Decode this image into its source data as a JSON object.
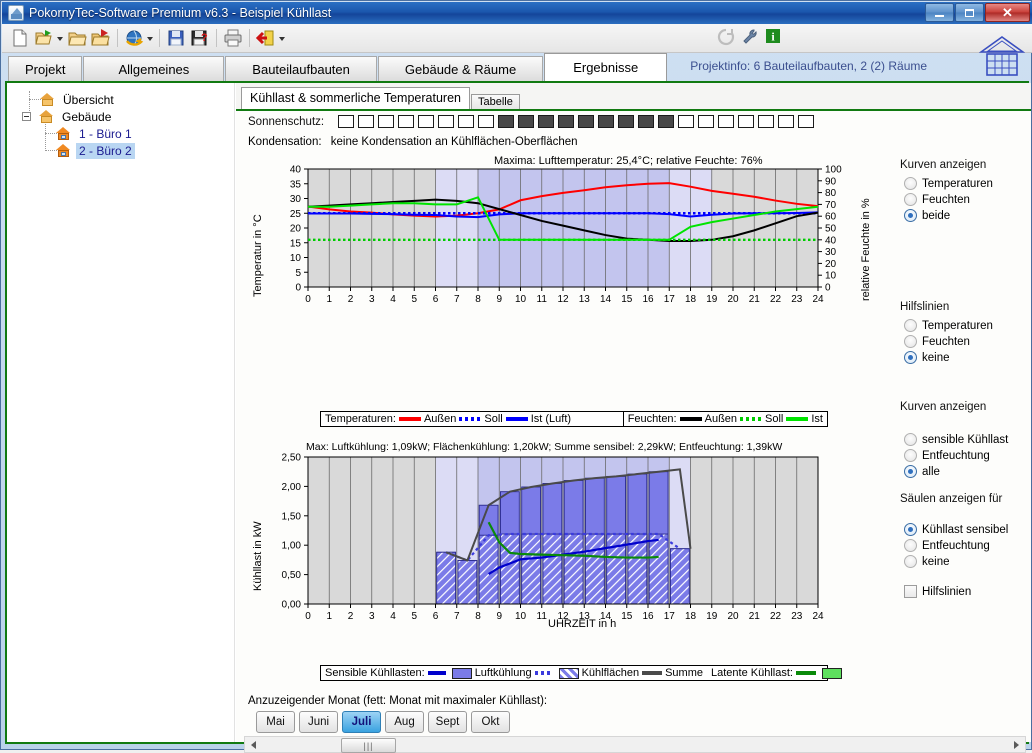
{
  "window": {
    "title": "PokornyTec-Software Premium v6.3  -  Beispiel Kühllast",
    "app_icon": "house-window-icon",
    "minimize_label": "–",
    "maximize_label": "□",
    "close_label": "✕"
  },
  "toolbar": {
    "buttons": [
      {
        "name": "new-document-icon",
        "tip": "Neu"
      },
      {
        "name": "open-recent-icon",
        "tip": "Zuletzt geöffnet"
      },
      {
        "name": "open-folder-icon",
        "tip": "Öffnen"
      },
      {
        "name": "open-import-icon",
        "tip": "Importieren"
      },
      {
        "name": "refresh-globe-icon",
        "tip": "Aktualisieren"
      },
      {
        "name": "save-icon",
        "tip": "Speichern"
      },
      {
        "name": "save-as-icon",
        "tip": "Speichern unter"
      },
      {
        "name": "print-icon",
        "tip": "Drucken"
      },
      {
        "name": "exit-icon",
        "tip": "Beenden"
      }
    ],
    "right_icons": [
      {
        "name": "refresh-circle-icon"
      },
      {
        "name": "wrench-icon"
      },
      {
        "name": "info-icon",
        "label": "i"
      }
    ]
  },
  "tabs": {
    "items": [
      {
        "label": "Projekt",
        "selected": false
      },
      {
        "label": "Allgemeines",
        "selected": false
      },
      {
        "label": "Bauteilaufbauten",
        "selected": false
      },
      {
        "label": "Gebäude & Räume",
        "selected": false
      },
      {
        "label": "Ergebnisse",
        "selected": true
      }
    ],
    "projektinfo": "Projektinfo: 6 Bauteilaufbauten,  2 (2) Räume"
  },
  "tree": {
    "nodes": [
      {
        "label": "Übersicht",
        "indent": 1,
        "selected": false,
        "icon": "house-yellow-icon"
      },
      {
        "label": "Gebäude",
        "indent": 1,
        "selected": false,
        "icon": "house-yellow-icon",
        "expander": "−"
      },
      {
        "label": "1 - Büro 1",
        "indent": 2,
        "selected": false,
        "icon": "house-orange-icon"
      },
      {
        "label": "2 - Büro 2",
        "indent": 2,
        "selected": true,
        "icon": "house-orange-icon"
      }
    ]
  },
  "subtabs": {
    "items": [
      {
        "label": "Kühllast & sommerliche Temperaturen",
        "selected": true
      },
      {
        "label": "Tabelle",
        "selected": false
      }
    ]
  },
  "sonnenschutz": {
    "label": "Sonnenschutz:",
    "boxes": [
      0,
      0,
      0,
      0,
      0,
      0,
      0,
      0,
      1,
      1,
      1,
      1,
      1,
      1,
      1,
      1,
      1,
      0,
      0,
      0,
      0,
      0,
      0,
      0
    ]
  },
  "kondensation": {
    "label": "Kondensation:",
    "value": "keine Kondensation an Kühlflächen-Oberflächen"
  },
  "chart_data": [
    {
      "type": "line",
      "id": "temperatur-feuchte-chart",
      "title": "Maxima:  Lufttemperatur: 25,4°C;  relative Feuchte: 76%",
      "xlabel": "",
      "ylabel": "Temperatur in °C",
      "y2label": "relative Feuchte in %",
      "xlim": [
        0,
        24
      ],
      "ylim": [
        0,
        40
      ],
      "y2lim": [
        0,
        100
      ],
      "xticks": [
        0,
        1,
        2,
        3,
        4,
        5,
        6,
        7,
        8,
        9,
        10,
        11,
        12,
        13,
        14,
        15,
        16,
        17,
        18,
        19,
        20,
        21,
        22,
        23,
        24
      ],
      "yticks": [
        0,
        5,
        10,
        15,
        20,
        25,
        30,
        35,
        40
      ],
      "y2ticks": [
        0,
        10,
        20,
        30,
        40,
        50,
        60,
        70,
        80,
        90,
        100
      ],
      "grid": true,
      "shading": [
        {
          "from": 0,
          "to": 6,
          "color": "#d9d9d9"
        },
        {
          "from": 6,
          "to": 8,
          "color": "#dcdcf5"
        },
        {
          "from": 8,
          "to": 17,
          "color": "#c3c5ee"
        },
        {
          "from": 17,
          "to": 19,
          "color": "#dcdcf5"
        },
        {
          "from": 19,
          "to": 24,
          "color": "#d9d9d9"
        }
      ],
      "x": [
        0,
        1,
        2,
        3,
        4,
        5,
        6,
        7,
        8,
        9,
        10,
        11,
        12,
        13,
        14,
        15,
        16,
        17,
        18,
        19,
        20,
        21,
        22,
        23,
        24
      ],
      "series": [
        {
          "name": "Außen",
          "group": "Temperaturen",
          "color": "#ff0000",
          "style": "solid",
          "axis": "left",
          "values": [
            27.3,
            26.3,
            25.6,
            25.2,
            24.6,
            24.2,
            23.9,
            24.2,
            25.0,
            26.3,
            29.4,
            30.8,
            31.9,
            32.8,
            33.8,
            34.5,
            35.0,
            35.2,
            34.0,
            32.6,
            31.6,
            30.6,
            29.3,
            28.2,
            27.4
          ]
        },
        {
          "name": "Soll",
          "group": "Temperaturen",
          "color": "#0000ff",
          "style": "dotted",
          "axis": "left",
          "values": [
            25.0,
            25.0,
            25.0,
            25.0,
            25.0,
            25.0,
            25.0,
            25.0,
            25.0,
            25.0,
            25.0,
            25.0,
            25.0,
            25.0,
            25.0,
            25.0,
            25.0,
            25.0,
            25.0,
            25.0,
            25.0,
            25.0,
            25.0,
            25.0,
            25.0
          ]
        },
        {
          "name": "Ist (Luft)",
          "group": "Temperaturen",
          "color": "#0000ff",
          "style": "solid",
          "axis": "left",
          "values": [
            24.9,
            24.9,
            24.9,
            24.8,
            24.7,
            24.5,
            24.4,
            23.9,
            23.7,
            24.6,
            25.0,
            25.0,
            25.0,
            25.0,
            25.0,
            25.0,
            25.0,
            24.7,
            23.9,
            24.5,
            24.9,
            25.0,
            25.0,
            25.1,
            25.3
          ]
        },
        {
          "name": "Außen",
          "group": "Feuchten",
          "color": "#000000",
          "style": "solid",
          "axis": "right",
          "values": [
            68,
            69,
            70,
            71,
            72,
            73,
            74,
            73,
            71,
            66,
            61,
            56,
            52,
            48,
            44,
            41,
            40,
            39,
            39,
            40,
            43,
            48,
            54,
            60,
            63
          ]
        },
        {
          "name": "Soll",
          "group": "Feuchten",
          "color": "#00cc00",
          "style": "dotted",
          "axis": "right",
          "values": [
            40,
            40,
            40,
            40,
            40,
            40,
            40,
            40,
            40,
            40,
            40,
            40,
            40,
            40,
            40,
            40,
            40,
            40,
            40,
            40,
            40,
            40,
            40,
            40,
            40
          ]
        },
        {
          "name": "Ist",
          "group": "Feuchten",
          "color": "#00e400",
          "style": "solid",
          "axis": "right",
          "values": [
            68,
            68,
            69,
            70,
            71,
            71,
            70,
            70,
            76,
            40,
            40,
            40,
            40,
            40,
            40,
            40,
            40,
            40,
            51,
            55,
            58,
            61,
            64,
            66,
            68
          ]
        }
      ],
      "legend": {
        "position": "bottom",
        "groups": [
          {
            "title": "Temperaturen:",
            "entries": [
              {
                "label": "Außen",
                "color": "#ff0000",
                "style": "solid"
              },
              {
                "label": "Soll",
                "color": "#0000ff",
                "style": "dotted"
              },
              {
                "label": "Ist (Luft)",
                "color": "#0000ff",
                "style": "solid"
              }
            ]
          },
          {
            "title": "Feuchten:",
            "entries": [
              {
                "label": "Außen",
                "color": "#000000",
                "style": "solid"
              },
              {
                "label": "Soll",
                "color": "#00cc00",
                "style": "dotted"
              },
              {
                "label": "Ist",
                "color": "#00e400",
                "style": "solid"
              }
            ]
          }
        ]
      }
    },
    {
      "type": "bar",
      "id": "kuehllast-chart",
      "title": "Max: Luftkühlung: 1,09kW; Flächenkühlung: 1,20kW; Summe sensibel: 2,29kW; Entfeuchtung: 1,39kW",
      "xlabel": "UHRZEIT in h",
      "ylabel": "Kühllast in kW",
      "xlim": [
        0,
        24
      ],
      "ylim": [
        0,
        2.5
      ],
      "xticks": [
        0,
        1,
        2,
        3,
        4,
        5,
        6,
        7,
        8,
        9,
        10,
        11,
        12,
        13,
        14,
        15,
        16,
        17,
        18,
        19,
        20,
        21,
        22,
        23,
        24
      ],
      "yticks": [
        "0,00",
        "0,50",
        "1,00",
        "1,50",
        "2,00",
        "2,50"
      ],
      "grid": true,
      "shading": [
        {
          "from": 0,
          "to": 6,
          "color": "#d9d9d9"
        },
        {
          "from": 6,
          "to": 8,
          "color": "#dcdcf5"
        },
        {
          "from": 8,
          "to": 17,
          "color": "#c3c5ee"
        },
        {
          "from": 17,
          "to": 18,
          "color": "#dcdcf5"
        },
        {
          "from": 18,
          "to": 24,
          "color": "#d9d9d9"
        }
      ],
      "categories": [
        6,
        7,
        8,
        9,
        10,
        11,
        12,
        13,
        14,
        15,
        16,
        17
      ],
      "bars_solid": {
        "name": "Summe sensibel",
        "color": "#6a6ae0",
        "values": [
          0.88,
          0.74,
          1.68,
          1.91,
          1.99,
          2.05,
          2.1,
          2.14,
          2.17,
          2.21,
          2.25,
          0.94
        ]
      },
      "bars_hatched": {
        "name": "Kühlflächen",
        "color": "#6a6ae0",
        "values": [
          0.88,
          0.74,
          1.17,
          1.19,
          1.19,
          1.19,
          1.19,
          1.19,
          1.19,
          1.19,
          1.19,
          0.94
        ]
      },
      "series": [
        {
          "name": "Luftkühlung",
          "color": "#0000cc",
          "style": "solid",
          "x": [
            8.5,
            9,
            10,
            11,
            12,
            13,
            14,
            15,
            16,
            16.5
          ],
          "values": [
            0.51,
            0.62,
            0.76,
            0.79,
            0.84,
            0.89,
            0.95,
            1.01,
            1.07,
            1.09
          ]
        },
        {
          "name": "Kühlflächen",
          "color": "#3b3bdd",
          "style": "dashed",
          "x": [
            6,
            7,
            8,
            9,
            10,
            11,
            12,
            13,
            14,
            15,
            16,
            17
          ],
          "values": [
            0.88,
            0.74,
            1.17,
            1.19,
            1.19,
            1.19,
            1.19,
            1.19,
            1.19,
            1.19,
            1.19,
            0.94
          ]
        },
        {
          "name": "Summe",
          "color": "#4a4a4a",
          "style": "solid",
          "x": [
            6,
            7,
            8,
            9,
            10,
            11,
            12,
            13,
            14,
            15,
            16,
            17,
            17.5
          ],
          "values": [
            0.88,
            0.74,
            1.68,
            1.91,
            1.99,
            2.05,
            2.1,
            2.14,
            2.17,
            2.21,
            2.25,
            2.29,
            0.94
          ]
        },
        {
          "name": "Latente Kühllast",
          "color": "#0a8a0a",
          "style": "solid",
          "x": [
            8.5,
            9,
            9.5,
            10,
            11,
            12,
            13,
            14,
            15,
            16,
            16.5
          ],
          "values": [
            1.39,
            1.05,
            0.87,
            0.85,
            0.84,
            0.83,
            0.82,
            0.8,
            0.79,
            0.79,
            0.8
          ]
        }
      ],
      "legend": {
        "position": "bottom",
        "groups": [
          {
            "title": "Sensible Kühllasten:",
            "entries": [
              {
                "label": "Luftkühlung",
                "color": "#0000cc",
                "style": "solid-swatch"
              },
              {
                "label": "Kühlflächen",
                "color": "#3b3bdd",
                "style": "dashed-hatch"
              },
              {
                "label": "Summe",
                "color": "#4a4a4a",
                "style": "solid"
              }
            ]
          },
          {
            "title": "Latente Kühllast:",
            "entries": [
              {
                "label": "",
                "color": "#0a8a0a",
                "style": "solid-swatch-green"
              }
            ]
          }
        ]
      }
    }
  ],
  "options": {
    "groups": [
      {
        "title": "Kurven anzeigen",
        "name": "kurven-anzeigen-temperaturen",
        "type": "radio",
        "items": [
          {
            "label": "Temperaturen",
            "selected": false
          },
          {
            "label": "Feuchten",
            "selected": false
          },
          {
            "label": "beide",
            "selected": true
          }
        ]
      },
      {
        "title": "Hilfslinien",
        "name": "hilfslinien-temperaturen",
        "type": "radio",
        "items": [
          {
            "label": "Temperaturen",
            "selected": false
          },
          {
            "label": "Feuchten",
            "selected": false
          },
          {
            "label": "keine",
            "selected": true
          }
        ]
      },
      {
        "title": "Kurven anzeigen",
        "name": "kurven-anzeigen-kuehllast",
        "type": "radio",
        "items": [
          {
            "label": "sensible Kühllast",
            "selected": false
          },
          {
            "label": "Entfeuchtung",
            "selected": false
          },
          {
            "label": "alle",
            "selected": true
          }
        ]
      },
      {
        "title": "Säulen anzeigen für",
        "name": "saeulen-anzeigen",
        "type": "radio",
        "items": [
          {
            "label": "Kühllast sensibel",
            "selected": true
          },
          {
            "label": "Entfeuchtung",
            "selected": false
          },
          {
            "label": "keine",
            "selected": false
          }
        ]
      }
    ],
    "checkbox": {
      "label": "Hilfslinien",
      "checked": false
    }
  },
  "months": {
    "label": "Anzuzeigender Monat (fett: Monat mit maximaler Kühllast):",
    "items": [
      {
        "label": "Mai",
        "selected": false
      },
      {
        "label": "Juni",
        "selected": false
      },
      {
        "label": "Juli",
        "selected": true
      },
      {
        "label": "Aug",
        "selected": false
      },
      {
        "label": "Sept",
        "selected": false
      },
      {
        "label": "Okt",
        "selected": false
      }
    ]
  },
  "scrollbar": {
    "left_arrow": "◄",
    "right_arrow": "►",
    "thumb_grip": "|||"
  },
  "colors": {
    "accent_green": "#117a11",
    "title_blue": "#14459a",
    "selection_blue": "#b9d6f2",
    "link_blue": "#3b4f8f"
  }
}
